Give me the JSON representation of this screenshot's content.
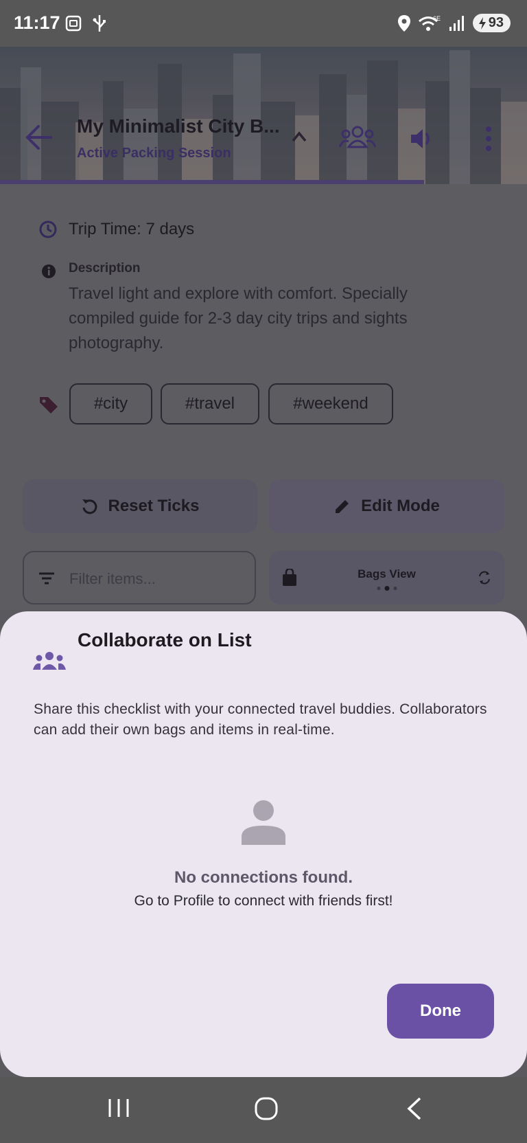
{
  "status_bar": {
    "time": "11:17",
    "battery": "93",
    "network": "6E"
  },
  "header": {
    "title": "My Minimalist City B...",
    "subtitle": "Active Packing Session"
  },
  "trip": {
    "time_label": "Trip Time: 7 days",
    "description_label": "Description",
    "description": "Travel light and explore with comfort. Specially compiled guide for 2-3 day city trips and sights photography.",
    "tags": [
      "#city",
      "#travel",
      "#weekend"
    ]
  },
  "actions": {
    "reset": "Reset Ticks",
    "edit": "Edit Mode"
  },
  "filter": {
    "placeholder": "Filter items..."
  },
  "view_switcher": {
    "label": "Bags View"
  },
  "sheet": {
    "title": "Collaborate on List",
    "description": "Share this checklist with your connected travel buddies. Collaborators can add their own bags and items in real-time.",
    "empty_title": "No connections found.",
    "empty_subtitle": "Go to Profile to connect with friends first!",
    "done": "Done"
  },
  "colors": {
    "accent": "#6a51a6",
    "sheet_bg": "#ece6f0",
    "icon_purple": "#6e58a8"
  }
}
